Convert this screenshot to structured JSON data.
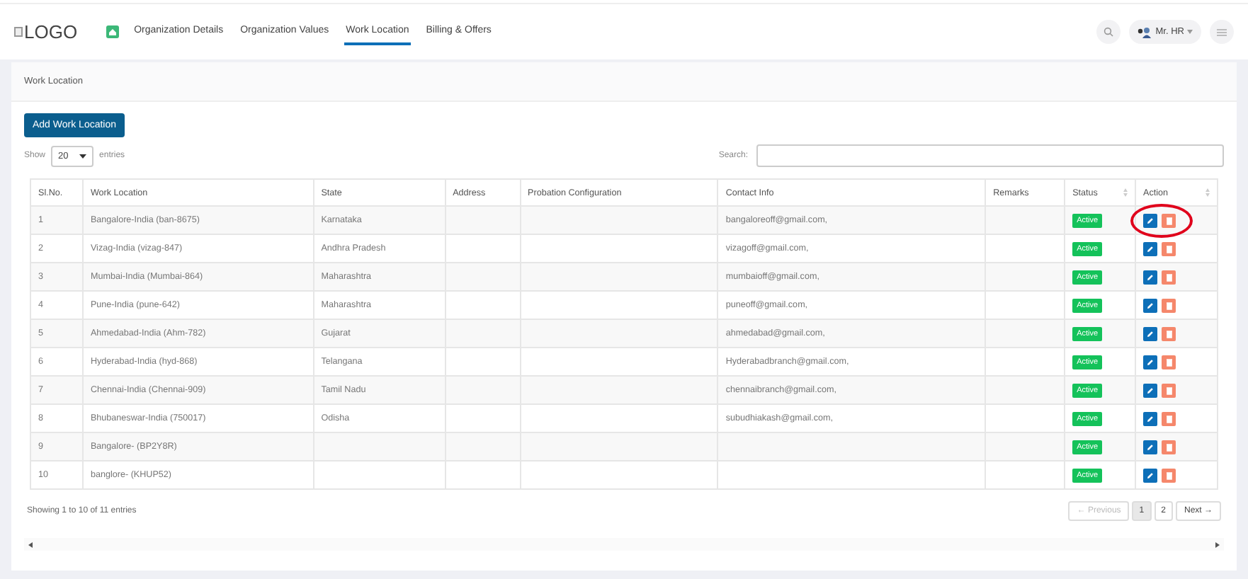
{
  "header": {
    "logo": "LOGO",
    "nav": [
      {
        "label": "Organization Details",
        "selected": false
      },
      {
        "label": "Organization Values",
        "selected": false
      },
      {
        "label": "Work Location",
        "selected": true
      },
      {
        "label": "Billing & Offers",
        "selected": false
      }
    ],
    "user": "Mr. HR"
  },
  "card": {
    "title": "Work Location",
    "add_button": "Add Work Location",
    "show_label": "Show",
    "page_size": "20",
    "entries_label": "entries",
    "search_label": "Search:",
    "table": {
      "columns": [
        {
          "label": "Sl.No.",
          "sortable": false
        },
        {
          "label": "Work Location",
          "sortable": false
        },
        {
          "label": "State",
          "sortable": false
        },
        {
          "label": "Address",
          "sortable": false
        },
        {
          "label": "Probation Configuration",
          "sortable": false
        },
        {
          "label": "Contact Info",
          "sortable": false
        },
        {
          "label": "Remarks",
          "sortable": false
        },
        {
          "label": "Status",
          "sortable": true
        },
        {
          "label": "Action",
          "sortable": true
        }
      ],
      "rows": [
        {
          "sl": "1",
          "location": "Bangalore-India (ban-8675)",
          "state": "Karnataka",
          "contact": "bangaloreoff@gmail.com,",
          "status": "Active",
          "circled": true
        },
        {
          "sl": "2",
          "location": "Vizag-India (vizag-847)",
          "state": "Andhra Pradesh",
          "contact": "vizagoff@gmail.com,",
          "status": "Active",
          "circled": false
        },
        {
          "sl": "3",
          "location": "Mumbai-India (Mumbai-864)",
          "state": "Maharashtra",
          "contact": "mumbaioff@gmail.com,",
          "status": "Active",
          "circled": false
        },
        {
          "sl": "4",
          "location": "Pune-India (pune-642)",
          "state": "Maharashtra",
          "contact": "puneoff@gmail.com,",
          "status": "Active",
          "circled": false
        },
        {
          "sl": "5",
          "location": "Ahmedabad-India (Ahm-782)",
          "state": "Gujarat",
          "contact": "ahmedabad@gmail.com,",
          "status": "Active",
          "circled": false
        },
        {
          "sl": "6",
          "location": "Hyderabad-India (hyd-868)",
          "state": "Telangana",
          "contact": "Hyderabadbranch@gmail.com,",
          "status": "Active",
          "circled": false
        },
        {
          "sl": "7",
          "location": "Chennai-India (Chennai-909)",
          "state": "Tamil Nadu",
          "contact": "chennaibranch@gmail.com,",
          "status": "Active",
          "circled": false
        },
        {
          "sl": "8",
          "location": "Bhubaneswar-India (750017)",
          "state": "Odisha",
          "contact": "subudhiakash@gmail.com,",
          "status": "Active",
          "circled": false
        },
        {
          "sl": "9",
          "location": "Bangalore- (BP2Y8R)",
          "status": "Active",
          "circled": false
        },
        {
          "sl": "10",
          "location": "banglore- (KHUP52)",
          "status": "Active",
          "circled": false
        }
      ]
    },
    "info": "Showing 1 to 10 of 11 entries",
    "pagination": [
      {
        "label": "← Previous",
        "kind": "prev",
        "disabled": true,
        "selected": false
      },
      {
        "label": "1",
        "kind": "page",
        "disabled": false,
        "selected": true
      },
      {
        "label": "2",
        "kind": "page",
        "disabled": false,
        "selected": false
      },
      {
        "label": "Next →",
        "kind": "next",
        "disabled": false,
        "selected": false
      }
    ]
  }
}
